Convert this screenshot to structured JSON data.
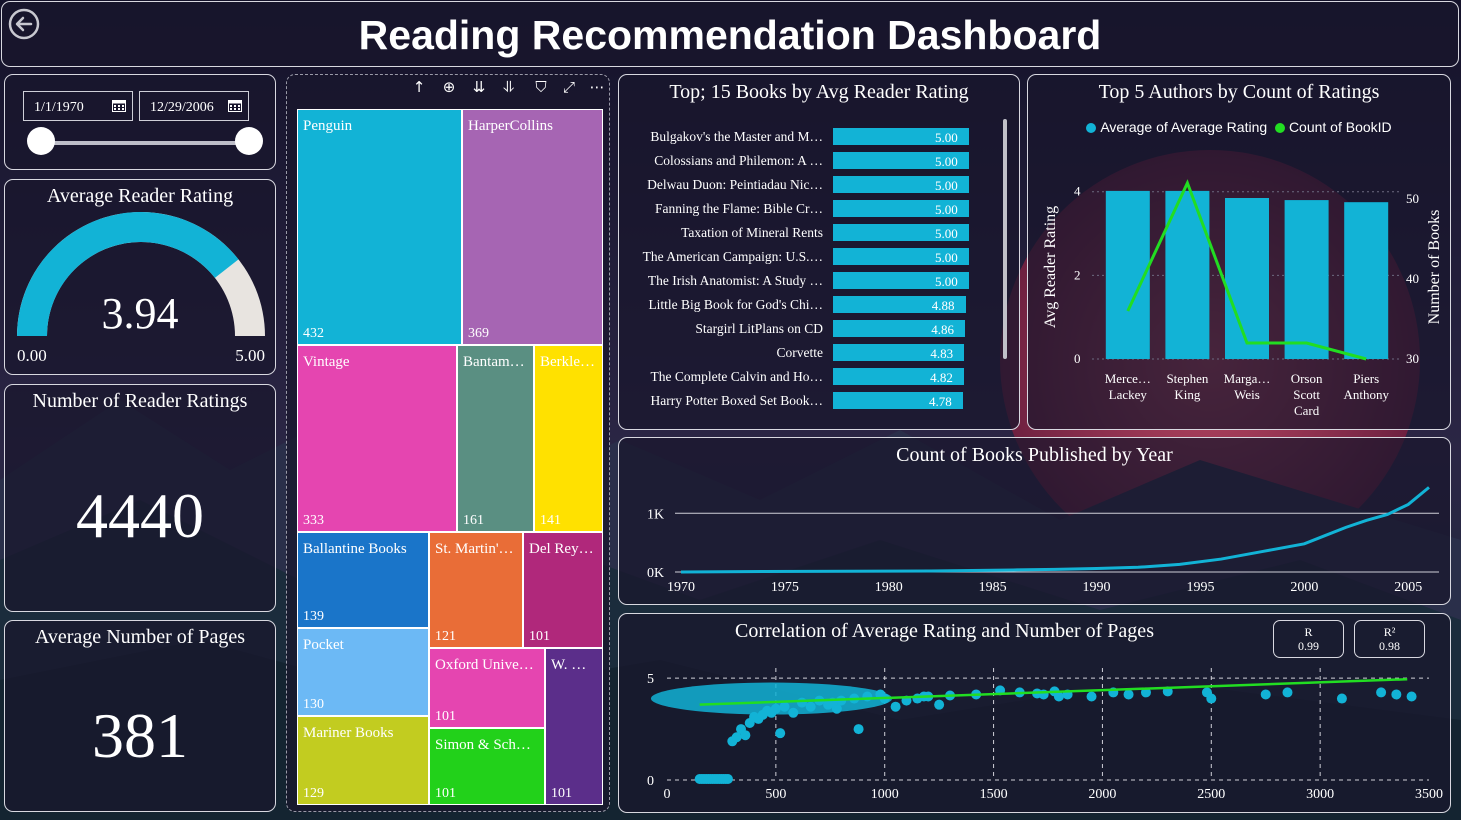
{
  "header": {
    "title": "Reading Recommendation Dashboard",
    "back_icon": "back-arrow-icon"
  },
  "date_filter": {
    "start": "1/1/1970",
    "end": "12/29/2006",
    "icon": "calendar-icon",
    "slider_start": 0,
    "slider_end": 1
  },
  "kpi_rating": {
    "title": "Average Reader Rating",
    "value": "3.94",
    "value_num": 3.94,
    "min": "0.00",
    "max": "5.00"
  },
  "kpi_ratings_count": {
    "title": "Number of Reader Ratings",
    "value": "4440"
  },
  "kpi_pages": {
    "title": "Average Number of Pages",
    "value": "381"
  },
  "treemap": {
    "cells": [
      {
        "name": "Penguin",
        "value": "432",
        "color": "#12b3d6"
      },
      {
        "name": "HarperCollins",
        "value": "369",
        "color": "#a665b3"
      },
      {
        "name": "Vintage",
        "value": "333",
        "color": "#e545b0"
      },
      {
        "name": "Bantam…",
        "value": "161",
        "color": "#5a8f82"
      },
      {
        "name": "Berkle…",
        "value": "141",
        "color": "#ffe100"
      },
      {
        "name": "Ballantine Books",
        "value": "139",
        "color": "#1a75c9"
      },
      {
        "name": "St. Martin'…",
        "value": "121",
        "color": "#e96d37"
      },
      {
        "name": "Del Rey…",
        "value": "101",
        "color": "#b0287b"
      },
      {
        "name": "Pocket",
        "value": "130",
        "color": "#6cb9f5"
      },
      {
        "name": "Oxford Unive…",
        "value": "101",
        "color": "#e545b0"
      },
      {
        "name": "W. …",
        "value": "101",
        "color": "#5b2e8a"
      },
      {
        "name": "Mariner Books",
        "value": "129",
        "color": "#c2cc20"
      },
      {
        "name": "Simon & Sch…",
        "value": "101",
        "color": "#22d11a"
      }
    ],
    "toolbar": [
      "drill-up-icon",
      "drill-down-icon",
      "expand-all-icon",
      "expand-next-icon",
      "filter-icon",
      "focus-mode-icon",
      "more-options-icon"
    ]
  },
  "top_books": {
    "title": "Top; 15 Books by Avg Reader Rating",
    "max": 5.0,
    "items": [
      {
        "label": "Bulgakov's the Master and M…",
        "value": 5.0,
        "text": "5.00"
      },
      {
        "label": "Colossians and Philemon: A …",
        "value": 5.0,
        "text": "5.00"
      },
      {
        "label": "Delwau Duon: Peintiadau Nic…",
        "value": 5.0,
        "text": "5.00"
      },
      {
        "label": "Fanning the Flame: Bible Cr…",
        "value": 5.0,
        "text": "5.00"
      },
      {
        "label": "Taxation of Mineral Rents",
        "value": 5.0,
        "text": "5.00"
      },
      {
        "label": "The American Campaign: U.S.…",
        "value": 5.0,
        "text": "5.00"
      },
      {
        "label": "The Irish Anatomist: A Study …",
        "value": 5.0,
        "text": "5.00"
      },
      {
        "label": "Little Big Book for God's Chi…",
        "value": 4.88,
        "text": "4.88"
      },
      {
        "label": "Stargirl LitPlans on CD",
        "value": 4.86,
        "text": "4.86"
      },
      {
        "label": "Corvette",
        "value": 4.83,
        "text": "4.83"
      },
      {
        "label": "The Complete Calvin and Ho…",
        "value": 4.82,
        "text": "4.82"
      },
      {
        "label": "Harry Potter Boxed Set Book…",
        "value": 4.78,
        "text": "4.78"
      }
    ]
  },
  "chart_data": [
    {
      "type": "bar",
      "title": "Top 5 Authors by Count of Ratings",
      "categories": [
        "Merce… Lackey",
        "Stephen King",
        "Marga… Weis",
        "Orson Scott Card",
        "Piers Anthony"
      ],
      "category_lines": [
        [
          "Merce…",
          "Lackey"
        ],
        [
          "Stephen",
          "King"
        ],
        [
          "Marga…",
          "Weis"
        ],
        [
          "Orson",
          "Scott",
          "Card"
        ],
        [
          "Piers",
          "Anthony"
        ]
      ],
      "series": [
        {
          "name": "Average of Average Rating",
          "type": "bar",
          "axis": "left",
          "values": [
            4.02,
            4.02,
            3.85,
            3.8,
            3.75
          ],
          "color": "#12b3d6"
        },
        {
          "name": "Count of BookID",
          "type": "line",
          "axis": "right",
          "values": [
            36,
            52,
            32,
            32,
            30
          ],
          "color": "#22dd22"
        }
      ],
      "ylabel": "Avg Reader Rating",
      "ylabel_right": "Number of Books",
      "ylim": [
        0,
        4.4
      ],
      "ylim_right": [
        30,
        53
      ],
      "yticks": [
        0,
        2,
        4
      ],
      "yticks_right": [
        30,
        40,
        50
      ],
      "legend": "top"
    },
    {
      "type": "line",
      "title": "Count of Books Published by Year",
      "x": [
        1970,
        1972,
        1974,
        1976,
        1978,
        1980,
        1982,
        1984,
        1986,
        1988,
        1990,
        1992,
        1994,
        1996,
        1998,
        2000,
        2001,
        2002,
        2003,
        2004,
        2005,
        2006
      ],
      "values": [
        0,
        5,
        8,
        10,
        12,
        15,
        18,
        25,
        35,
        45,
        60,
        80,
        130,
        220,
        350,
        480,
        620,
        760,
        880,
        980,
        1150,
        1440
      ],
      "ylim": [
        0,
        1600
      ],
      "xticks": [
        1970,
        1975,
        1980,
        1985,
        1990,
        1995,
        2000,
        2005
      ],
      "yticks": [
        0,
        1000
      ],
      "ytick_labels": [
        "0K",
        "1K"
      ],
      "color": "#12b3d6",
      "grid": true
    },
    {
      "type": "scatter",
      "title": "Correlation of Average Rating and Number of Pages",
      "xlim": [
        0,
        3500
      ],
      "ylim": [
        0,
        5.5
      ],
      "xticks": [
        0,
        500,
        1000,
        1500,
        2000,
        2500,
        3000,
        3500
      ],
      "yticks": [
        0,
        5
      ],
      "trend": {
        "x": [
          150,
          3400
        ],
        "y": [
          3.7,
          4.95
        ],
        "color": "#22dd22"
      },
      "points_x": [
        1200,
        1300,
        1420,
        1530,
        1620,
        1700,
        1730,
        1780,
        1800,
        1840,
        1950,
        2050,
        2120,
        2200,
        2300,
        2480,
        2500,
        2750,
        2850,
        3100,
        3280,
        3350,
        3420,
        1050,
        1180,
        1250,
        1000,
        880,
        780,
        760,
        520,
        150,
        160,
        170,
        180,
        190,
        200,
        210,
        220,
        230,
        240,
        250,
        260,
        270,
        280,
        300,
        320,
        340,
        360,
        380,
        400,
        420,
        440,
        460,
        480,
        500,
        540,
        580,
        620,
        660,
        700,
        740,
        800,
        860,
        920,
        980,
        1100,
        1150
      ],
      "points_y": [
        4.1,
        4.15,
        4.2,
        4.4,
        4.3,
        4.25,
        4.2,
        4.35,
        4.1,
        4.2,
        4.1,
        4.3,
        4.2,
        4.3,
        4.35,
        4.3,
        4.0,
        4.2,
        4.3,
        4.0,
        4.3,
        4.2,
        4.1,
        3.6,
        4.1,
        3.7,
        4.0,
        2.5,
        3.5,
        3.8,
        2.3,
        0.05,
        0.05,
        0.05,
        0.05,
        0.05,
        0.05,
        0.05,
        0.05,
        0.05,
        0.05,
        0.05,
        0.05,
        0.05,
        0.05,
        1.9,
        2.1,
        2.5,
        2.2,
        2.8,
        3.1,
        3.0,
        3.2,
        3.4,
        3.3,
        3.5,
        3.6,
        3.3,
        3.8,
        3.6,
        3.9,
        3.7,
        3.9,
        4.0,
        4.1,
        4.2,
        3.9,
        4.0
      ],
      "color": "#12b3d6",
      "stats": {
        "r_label": "R",
        "r_value": "0.99",
        "r2_label": "R²",
        "r2_value": "0.98"
      }
    }
  ]
}
